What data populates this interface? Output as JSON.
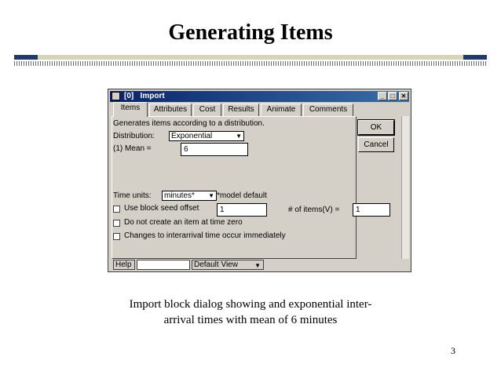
{
  "slide": {
    "title": "Generating Items",
    "caption_line1": "Import block dialog showing and exponential inter-",
    "caption_line2": "arrival times with mean of 6 minutes",
    "page_number": "3"
  },
  "window": {
    "title": "[0]   Import",
    "min_glyph": "_",
    "max_glyph": "□",
    "close_glyph": "✕"
  },
  "tabs": [
    "Items",
    "Attributes",
    "Cost",
    "Results",
    "Animate",
    "Comments"
  ],
  "form": {
    "description": "Generates items according to a distribution.",
    "distribution_label": "Distribution:",
    "distribution_value": "Exponential",
    "mean_label": "(1)   Mean =",
    "mean_value": "6",
    "time_units_label": "Time units:",
    "time_units_value": "minutes*",
    "model_default_note": "*model default",
    "seed_offset_label": "Use block seed offset",
    "seed_offset_value": "1",
    "num_items_label": "# of items(V) =",
    "num_items_value": "1",
    "no_item_zero_label": "Do not create an item at time zero",
    "interarrival_change_label": "Changes to interarrival time occur immediately"
  },
  "buttons": {
    "ok": "OK",
    "cancel": "Cancel"
  },
  "statusbar": {
    "help": "Help",
    "view": "Default View"
  },
  "colors": {
    "titlebar": "#0a246a",
    "face": "#d4d0c8",
    "rule_dark": "#1f3a6b"
  }
}
